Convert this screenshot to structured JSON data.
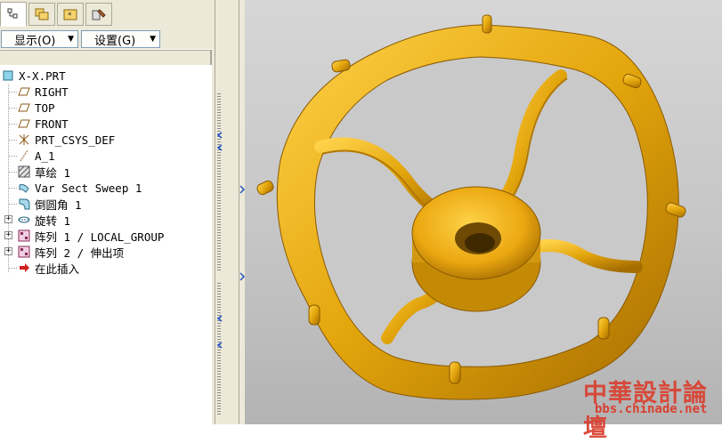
{
  "tabs": [
    {
      "icon": "model-tree-icon",
      "active": true
    },
    {
      "icon": "folder-browser-icon",
      "active": false
    },
    {
      "icon": "favorites-icon",
      "active": false
    },
    {
      "icon": "connections-icon",
      "active": false
    }
  ],
  "toolbar": {
    "show_label": "显示(O)",
    "settings_label": "设置(G)"
  },
  "tree": {
    "items": [
      {
        "label": "X-X.PRT",
        "icon": "part-icon"
      },
      {
        "label": "RIGHT",
        "icon": "datum-plane-icon"
      },
      {
        "label": "TOP",
        "icon": "datum-plane-icon"
      },
      {
        "label": "FRONT",
        "icon": "datum-plane-icon"
      },
      {
        "label": "PRT_CSYS_DEF",
        "icon": "coordinate-system-icon"
      },
      {
        "label": "A_1",
        "icon": "datum-axis-icon"
      },
      {
        "label": "草绘 1",
        "icon": "sketch-icon"
      },
      {
        "label": "Var Sect Sweep 1",
        "icon": "sweep-icon"
      },
      {
        "label": "倒圆角 1",
        "icon": "round-icon"
      },
      {
        "label": "旋转 1",
        "icon": "revolve-icon",
        "expandable": true
      },
      {
        "label": "阵列 1 / LOCAL_GROUP",
        "icon": "pattern-icon",
        "expandable": true
      },
      {
        "label": "阵列 2 / 伸出项",
        "icon": "pattern-icon",
        "expandable": true
      },
      {
        "label": "在此插入",
        "icon": "insert-here-icon"
      }
    ]
  },
  "watermark": {
    "title": "中華設計論壇",
    "url": "bbs.chinade.net"
  },
  "colors": {
    "model_gold": "#e3a50c",
    "model_highlight": "#ffd24a",
    "model_shadow": "#a56c00",
    "watermark": "#d94030"
  }
}
